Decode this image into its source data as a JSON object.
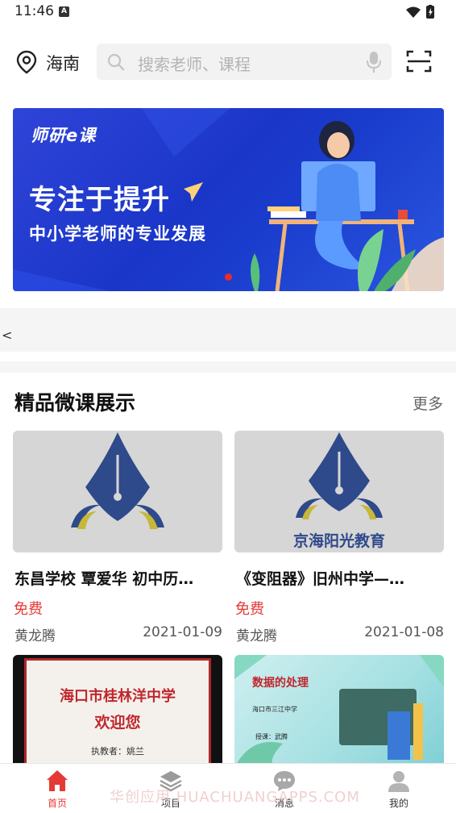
{
  "status_bar": {
    "time": "11:46",
    "notification_letter": "A"
  },
  "header": {
    "location": "海南",
    "search_placeholder": "搜索老师、课程"
  },
  "banner": {
    "logo_text": "师研e课",
    "title": "专注于提升",
    "subtitle": "中小学老师的专业发展",
    "accent_color": "#1a36c8",
    "dot_color": "#e82b2b"
  },
  "marquee": {
    "text": "<"
  },
  "section": {
    "title": "精品微课展示",
    "more_label": "更多"
  },
  "courses": [
    {
      "title": "东昌学校 覃爱华 初中历…",
      "price": "免费",
      "author": "黄龙腾",
      "date": "2021-01-09",
      "thumb_caption": ""
    },
    {
      "title": "《变阻器》旧州中学—…",
      "price": "免费",
      "author": "黄龙腾",
      "date": "2021-01-08",
      "thumb_caption": "京海阳光教育"
    }
  ],
  "courses_more": [
    {
      "line1": "海口市桂林洋中学",
      "line2": "欢迎您",
      "line3": "执教者：姚兰"
    },
    {
      "line1": "数据的处理",
      "line2": "海口市三江中学",
      "line3": "授课：武腾"
    }
  ],
  "bottom_nav": {
    "items": [
      {
        "label": "首页",
        "icon": "home-icon",
        "active": true
      },
      {
        "label": "项目",
        "icon": "layers-icon",
        "active": false
      },
      {
        "label": "消息",
        "icon": "message-icon",
        "active": false
      },
      {
        "label": "我的",
        "icon": "user-icon",
        "active": false
      }
    ],
    "active_color": "#e53935",
    "watermark": "华创应用 HUACHUANGAPPS.COM"
  }
}
